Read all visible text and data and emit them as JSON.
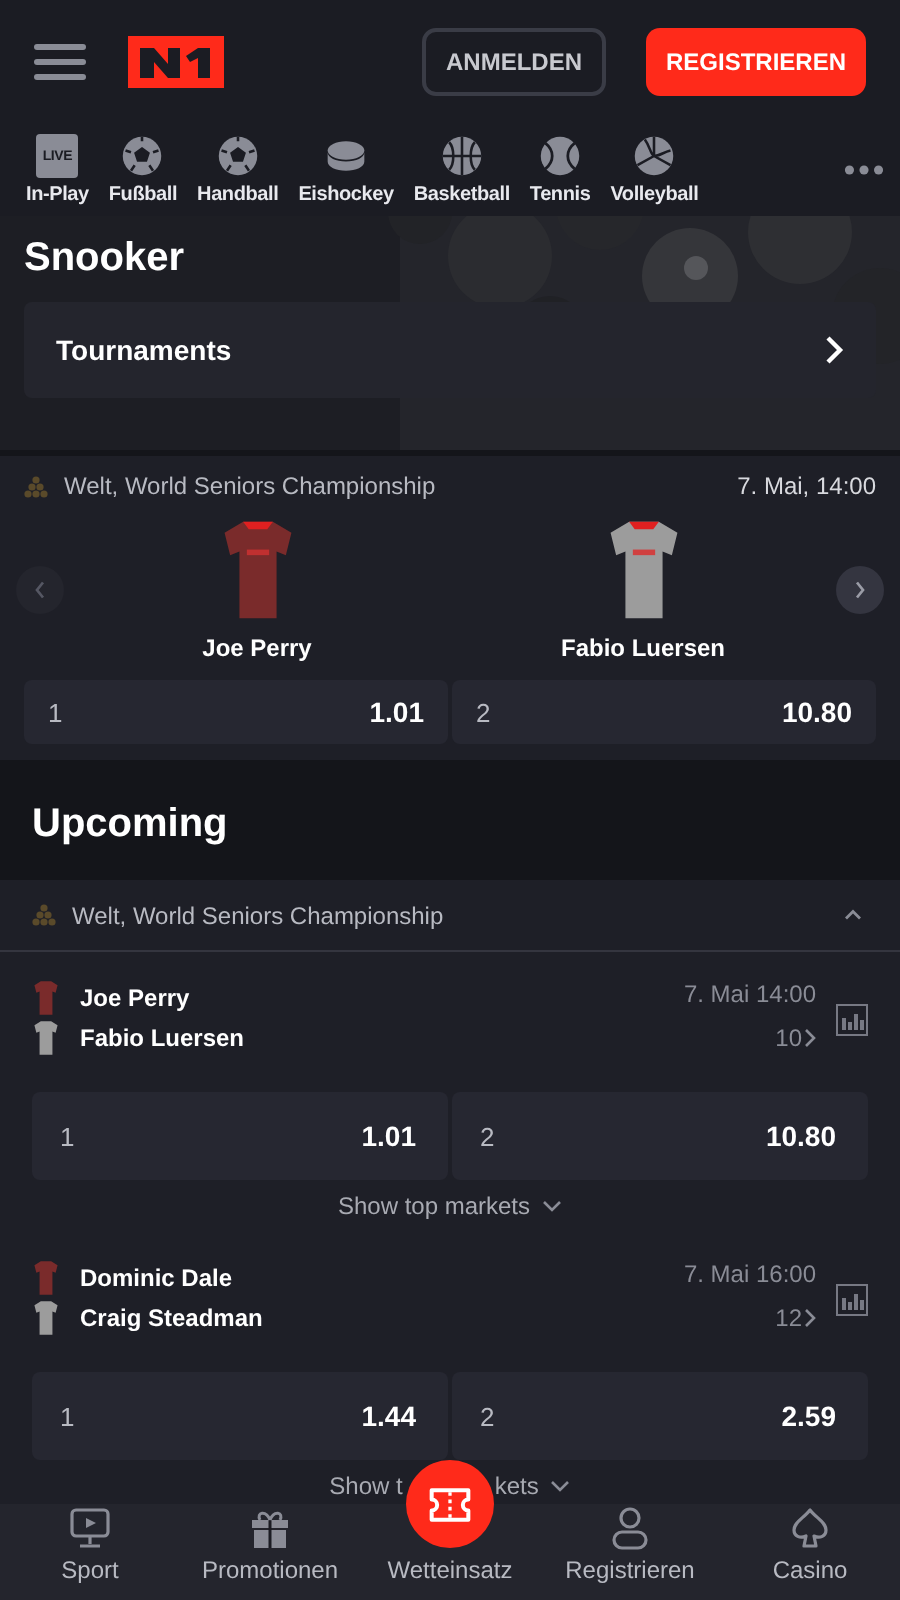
{
  "header": {
    "login": "ANMELDEN",
    "register": "REGISTRIEREN"
  },
  "sports": [
    {
      "label": "In-Play",
      "badge": "LIVE"
    },
    {
      "label": "Fußball"
    },
    {
      "label": "Handball"
    },
    {
      "label": "Eishockey"
    },
    {
      "label": "Basketball"
    },
    {
      "label": "Tennis"
    },
    {
      "label": "Volleyball"
    }
  ],
  "hero": {
    "title": "Snooker",
    "tournaments": "Tournaments"
  },
  "featured": {
    "league": "Welt, World Seniors Championship",
    "time": "7. Mai, 14:00",
    "home": "Joe Perry",
    "away": "Fabio Luersen",
    "odds": [
      {
        "label": "1",
        "value": "1.01"
      },
      {
        "label": "2",
        "value": "10.80"
      }
    ]
  },
  "upcoming": {
    "title": "Upcoming",
    "league": "Welt, World Seniors Championship",
    "expanded": true,
    "matches": [
      {
        "home": "Joe Perry",
        "away": "Fabio Luersen",
        "time": "7. Mai 14:00",
        "markets": "10",
        "odds": [
          {
            "label": "1",
            "value": "1.01"
          },
          {
            "label": "2",
            "value": "10.80"
          }
        ],
        "more": [
          "Show top markets"
        ]
      },
      {
        "home": "Dominic Dale",
        "away": "Craig Steadman",
        "time": "7. Mai 16:00",
        "markets": "12",
        "odds": [
          {
            "label": "1",
            "value": "1.44"
          },
          {
            "label": "2",
            "value": "2.59"
          }
        ],
        "more": [
          "Show t",
          "kets"
        ]
      }
    ]
  },
  "bottom_nav": [
    {
      "label": "Sport",
      "kind": "tab"
    },
    {
      "label": "Promotionen",
      "kind": "tab"
    },
    {
      "label": "Wetteinsatz",
      "kind": "center"
    },
    {
      "label": "Registrieren",
      "kind": "tab"
    },
    {
      "label": "Casino",
      "kind": "tab"
    }
  ]
}
